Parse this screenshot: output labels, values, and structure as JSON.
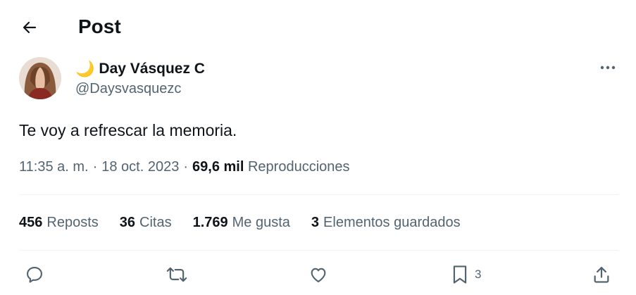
{
  "header": {
    "title": "Post",
    "back_icon": "arrow-left-icon"
  },
  "author": {
    "display_name": "Day Vásquez C",
    "emoji": "🌙",
    "handle": "@Daysvasquezc"
  },
  "tweet": {
    "text": "Te voy a refrescar la memoria.",
    "time": "11:35 a. m.",
    "separator1": "·",
    "date": "18 oct. 2023",
    "separator2": "·",
    "views_count": "69,6 mil",
    "views_label": "Reproducciones"
  },
  "stats": [
    {
      "count": "456",
      "label": "Reposts"
    },
    {
      "count": "36",
      "label": "Citas"
    },
    {
      "count": "1.769",
      "label": "Me gusta"
    },
    {
      "count": "3",
      "label": "Elementos guardados"
    }
  ],
  "actions": {
    "reply_icon": "comment-icon",
    "repost_icon": "repost-icon",
    "like_icon": "heart-icon",
    "bookmark_icon": "bookmark-icon",
    "bookmark_count": "3",
    "share_icon": "share-icon"
  },
  "colors": {
    "text": "#0f1419",
    "secondary": "#536471",
    "divider": "#eff3f4"
  }
}
